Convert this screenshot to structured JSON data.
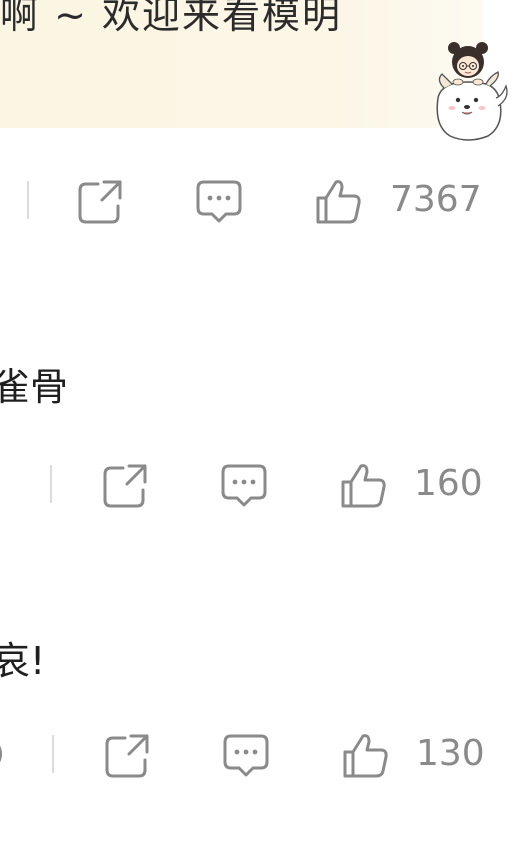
{
  "banner": {
    "text": "啊 ~ 欢迎来看模明"
  },
  "posts": [
    {
      "title": "",
      "likes": "7367"
    },
    {
      "title": "雀骨",
      "likes": "160"
    },
    {
      "title": "哀!",
      "likes": "130"
    }
  ],
  "colors": {
    "banner_bg": "#fbf5e3",
    "icon_gray": "#8a8a8a",
    "divider": "#dcdcdc"
  },
  "icons": {
    "share": "share-icon",
    "comment": "comment-icon",
    "like": "thumbs-up-icon",
    "mascot": "cartoon-girl-and-dog"
  }
}
